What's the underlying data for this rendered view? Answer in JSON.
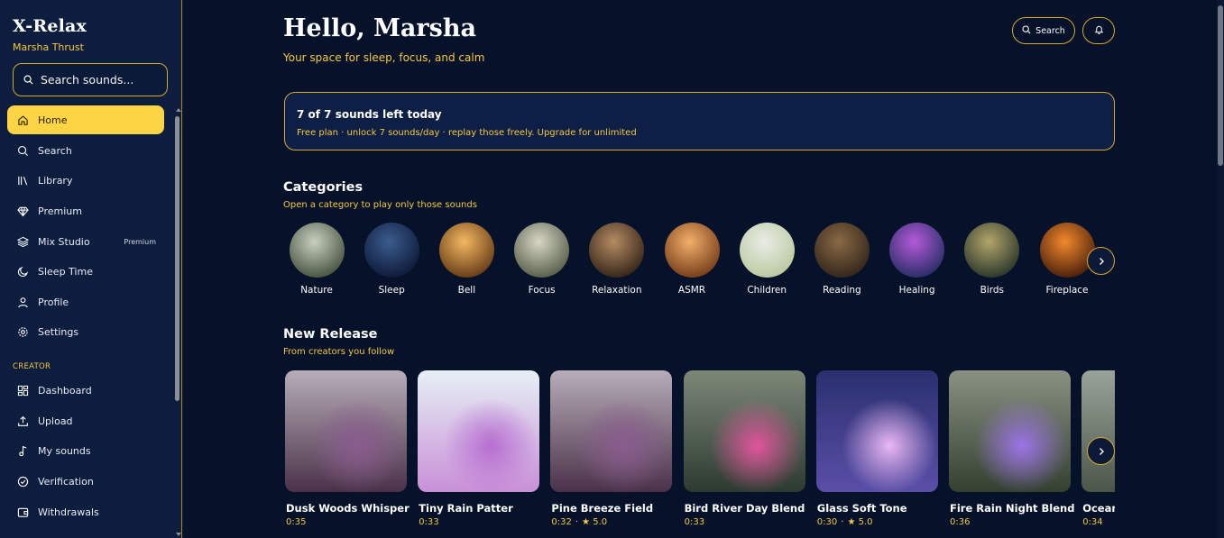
{
  "sidebar": {
    "brand": "X-Relax",
    "user_name": "Marsha Thrust",
    "search_placeholder": "Search sounds...",
    "items": [
      {
        "label": "Home",
        "icon": "home-icon",
        "active": true
      },
      {
        "label": "Search",
        "icon": "search-icon"
      },
      {
        "label": "Library",
        "icon": "library-icon"
      },
      {
        "label": "Premium",
        "icon": "diamond-icon"
      },
      {
        "label": "Mix Studio",
        "icon": "layers-icon",
        "badge": "Premium"
      },
      {
        "label": "Sleep Time",
        "icon": "moon-icon"
      },
      {
        "label": "Profile",
        "icon": "user-icon"
      },
      {
        "label": "Settings",
        "icon": "gear-icon"
      }
    ],
    "creator_label": "CREATOR",
    "creator_items": [
      {
        "label": "Dashboard",
        "icon": "dashboard-icon"
      },
      {
        "label": "Upload",
        "icon": "upload-icon"
      },
      {
        "label": "My sounds",
        "icon": "music-note-icon"
      },
      {
        "label": "Verification",
        "icon": "check-circle-icon"
      },
      {
        "label": "Withdrawals",
        "icon": "wallet-icon"
      }
    ]
  },
  "header": {
    "greeting": "Hello, Marsha",
    "subtitle": "Your space for sleep, focus, and calm",
    "search_label": "Search",
    "bell_icon": "bell-icon"
  },
  "banner": {
    "title": "7 of 7 sounds left today",
    "subtitle": "Free plan · unlock 7 sounds/day · replay those freely. Upgrade for unlimited"
  },
  "categories": {
    "title": "Categories",
    "subtitle": "Open a category to play only those sounds",
    "items": [
      {
        "label": "Nature",
        "c1": "#c9cfc0",
        "c2": "#3d4a34"
      },
      {
        "label": "Sleep",
        "c1": "#3a5d8f",
        "c2": "#0b1430"
      },
      {
        "label": "Bell",
        "c1": "#f4b860",
        "c2": "#5a3210"
      },
      {
        "label": "Focus",
        "c1": "#d8d6c6",
        "c2": "#4c5540"
      },
      {
        "label": "Relaxation",
        "c1": "#b58c63",
        "c2": "#2a1c12"
      },
      {
        "label": "ASMR",
        "c1": "#f3b06a",
        "c2": "#6b3413"
      },
      {
        "label": "Children",
        "c1": "#e8ede6",
        "c2": "#b8c69a"
      },
      {
        "label": "Reading",
        "c1": "#8a6a44",
        "c2": "#2b2018"
      },
      {
        "label": "Healing",
        "c1": "#b45ad8",
        "c2": "#1c2a5e"
      },
      {
        "label": "Birds",
        "c1": "#b3a56b",
        "c2": "#1f2e24"
      },
      {
        "label": "Fireplace",
        "c1": "#f38a2c",
        "c2": "#3c1608"
      }
    ]
  },
  "new_release": {
    "title": "New Release",
    "subtitle": "From creators you follow",
    "items": [
      {
        "title": "Dusk Woods Whisper",
        "duration": "0:35",
        "rating": "",
        "c1": "#b7adb8",
        "c2": "#4a3148",
        "c3": "#8a5b8e"
      },
      {
        "title": "Tiny Rain Patter",
        "duration": "0:33",
        "rating": "",
        "c1": "#e6f0f5",
        "c2": "#c98fd8",
        "c3": "#b76ed0"
      },
      {
        "title": "Pine Breeze Field",
        "duration": "0:32",
        "rating": "5.0",
        "c1": "#b7adb8",
        "c2": "#4a3148",
        "c3": "#8a5b8e"
      },
      {
        "title": "Bird River Day Blend",
        "duration": "0:33",
        "rating": "",
        "c1": "#7b8878",
        "c2": "#2d3a30",
        "c3": "#e0559c"
      },
      {
        "title": "Glass Soft Tone",
        "duration": "0:30",
        "rating": "5.0",
        "c1": "#2a2f6e",
        "c2": "#5a4fa8",
        "c3": "#e9b8f3"
      },
      {
        "title": "Fire Rain Night Blend",
        "duration": "0:36",
        "rating": "",
        "c1": "#8a9184",
        "c2": "#33402f",
        "c3": "#9c74e6"
      },
      {
        "title": "Ocean",
        "duration": "0:34",
        "rating": "",
        "c1": "#9aa39a",
        "c2": "#4a5648",
        "c3": "#707e6e"
      }
    ]
  },
  "colors": {
    "accent": "#fdd444",
    "gold_text": "#f5c842",
    "background": "#061229",
    "sidebar": "#0c1d3e"
  }
}
